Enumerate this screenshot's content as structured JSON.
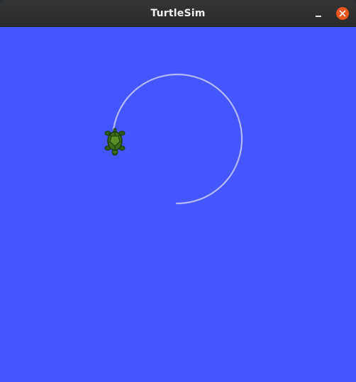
{
  "window": {
    "title": "TurtleSim"
  },
  "titlebar_buttons": {
    "minimize_icon": "minimize-icon",
    "close_icon": "close-icon"
  },
  "colors": {
    "background": "#4556ff",
    "pen": "#b3b8ff",
    "titlebar": "#2f2f2f",
    "close_button": "#e9541f",
    "turtle_shell": "#3b6e1a"
  },
  "turtle": {
    "icon": "turtle-icon"
  }
}
